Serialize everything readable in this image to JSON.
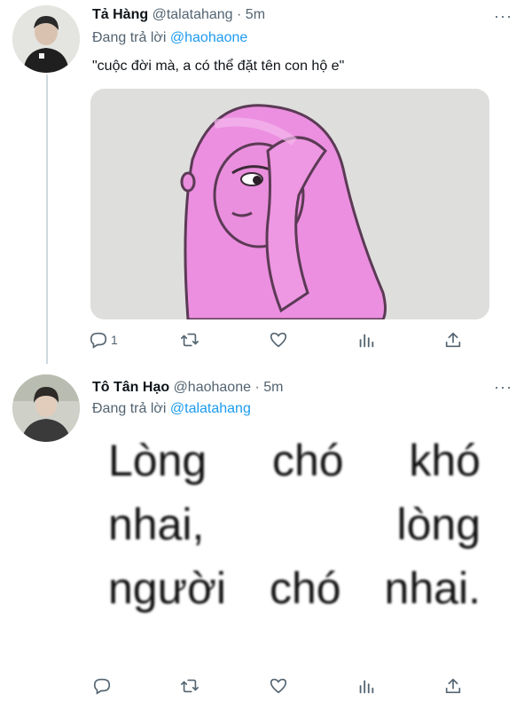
{
  "tweet1": {
    "name": "Tả Hàng",
    "handle": "@talatahang",
    "separator": "·",
    "time": "5m",
    "reply_prefix": "Đang trả lời",
    "reply_mention": "@haohaone",
    "text": "\"cuộc đời mà, a có thể đặt tên con hộ e\"",
    "reply_count": "1",
    "more": "···"
  },
  "tweet2": {
    "name": "Tô Tân Hạo",
    "handle": "@haohaone",
    "separator": "·",
    "time": "5m",
    "reply_prefix": "Đang trả lời",
    "reply_mention": "@talatahang",
    "more": "···",
    "image_text": {
      "line1": [
        "Lòng",
        "chó",
        "khó"
      ],
      "line2": [
        "nhai,",
        "lòng"
      ],
      "line3": [
        "người",
        "chó",
        "nhai."
      ]
    }
  },
  "icons": {
    "reply": "reply-icon",
    "retweet": "retweet-icon",
    "like": "like-icon",
    "analytics": "analytics-icon",
    "share": "share-icon",
    "more": "more-icon"
  },
  "colors": {
    "link": "#1d9bf0",
    "secondary_text": "#536471",
    "primary_text": "#0f1419",
    "thread_line": "#cfd9de"
  }
}
